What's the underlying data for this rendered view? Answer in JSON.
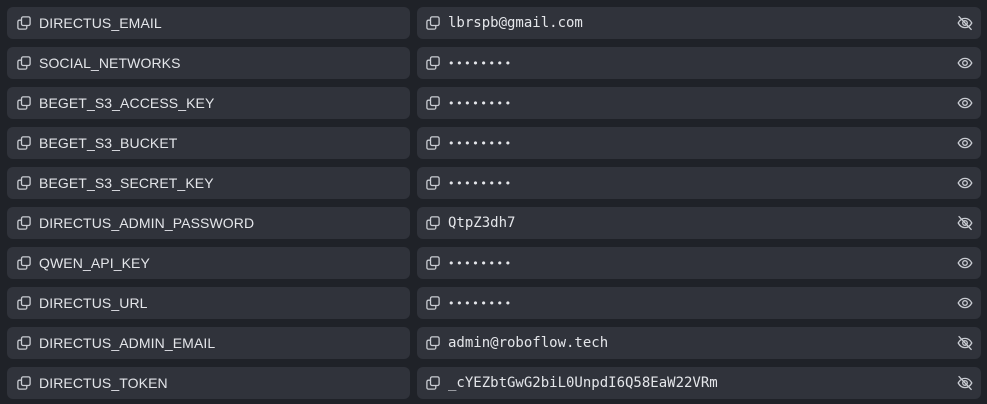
{
  "colors": {
    "background": "#1f2228",
    "cell": "#30333b",
    "text": "#e4e6ea",
    "icon": "#c9ccd2"
  },
  "rows": [
    {
      "key": "DIRECTUS_EMAIL",
      "value": "lbrspb@gmail.com",
      "visible": true
    },
    {
      "key": "SOCIAL_NETWORKS",
      "value": "••••••••",
      "visible": false
    },
    {
      "key": "BEGET_S3_ACCESS_KEY",
      "value": "••••••••",
      "visible": false
    },
    {
      "key": "BEGET_S3_BUCKET",
      "value": "••••••••",
      "visible": false
    },
    {
      "key": "BEGET_S3_SECRET_KEY",
      "value": "••••••••",
      "visible": false
    },
    {
      "key": "DIRECTUS_ADMIN_PASSWORD",
      "value": "QtpZ3dh7",
      "visible": true
    },
    {
      "key": "QWEN_API_KEY",
      "value": "••••••••",
      "visible": false
    },
    {
      "key": "DIRECTUS_URL",
      "value": "••••••••",
      "visible": false
    },
    {
      "key": "DIRECTUS_ADMIN_EMAIL",
      "value": "admin@roboflow.tech",
      "visible": true
    },
    {
      "key": "DIRECTUS_TOKEN",
      "value": "_cYEZbtGwG2biL0UnpdI6Q58EaW22VRm",
      "visible": true
    }
  ]
}
